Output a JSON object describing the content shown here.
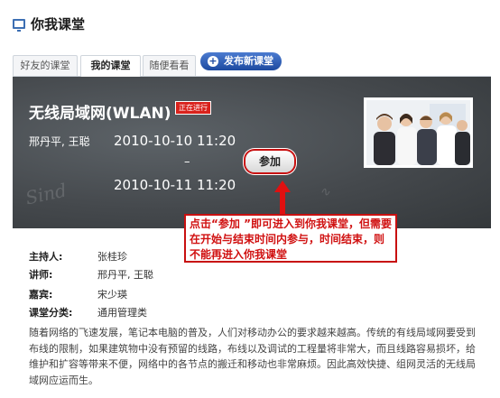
{
  "header": {
    "title": "你我课堂",
    "icon": "monitor-icon"
  },
  "tabs": [
    {
      "label": "好友的课堂"
    },
    {
      "label": "我的课堂"
    },
    {
      "label": "随便看看"
    }
  ],
  "publish_label": "发布新课堂",
  "course": {
    "title": "无线局域网(WLAN)",
    "status": "正在进行",
    "teachers": "邢丹平, 王聪",
    "start": "2010-10-10 11:20",
    "separator": "–",
    "end": "2010-10-11 11:20",
    "join_label": "参加"
  },
  "annotation": "点击“参加 ”即可进入到你我课堂，但需要在开始与结束时间内参与，时间结束，则不能再进入你我课堂",
  "details": [
    {
      "label": "主持人:",
      "value": "张桂珍"
    },
    {
      "label": "讲师:",
      "value": "邢丹平, 王聪"
    },
    {
      "label": "嘉宾:",
      "value": "宋少瑛"
    },
    {
      "label": "课堂分类:",
      "value": "通用管理类"
    }
  ],
  "description": "随着网络的飞速发展，笔记本电脑的普及，人们对移动办公的要求越来越高。传统的有线局域网要受到布线的限制，如果建筑物中没有预留的线路，布线以及调试的工程量将非常大，而且线路容易损坏，给维护和扩容等带来不便，网络中的各节点的搬迁和移动也非常麻烦。因此高效快捷、组网灵活的无线局域网应运而生。",
  "colors": {
    "accent": "#1d4aa0",
    "alert": "#c81010",
    "board": "#45494d"
  }
}
